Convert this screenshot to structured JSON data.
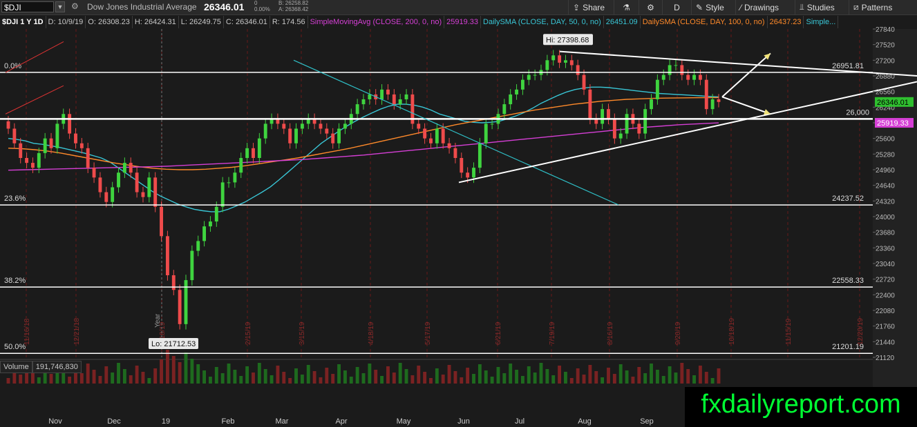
{
  "toolbar": {
    "symbol": "$DJI",
    "description": "Dow Jones Industrial Average",
    "last": "26346.01",
    "change_top": "0",
    "change_pct": "0.00%",
    "bid": "B: 26258.82",
    "ask": "A: 26368.42",
    "share": "Share",
    "period": "D",
    "style": "Style",
    "drawings": "Drawings",
    "studies": "Studies",
    "patterns": "Patterns"
  },
  "header": {
    "title": "$DJI 1 Y 1D",
    "date": "D: 10/9/19",
    "open": "O: 26308.23",
    "high": "H: 26424.31",
    "low": "L: 26249.75",
    "close": "C: 26346.01",
    "range": "R: 174.56",
    "sma200_label": "SimpleMovingAvg (CLOSE, 200, 0, no)",
    "sma200_value": "25919.33",
    "sma50_label": "DailySMA (CLOSE, DAY, 50, 0, no)",
    "sma50_value": "26451.09",
    "sma100_label": "DailySMA (CLOSE, DAY, 100, 0, no)",
    "sma100_value": "26437.23",
    "more": "Simple..."
  },
  "volume": {
    "label": "Volume",
    "value": "191,746,830"
  },
  "watermark": "fxdailyreport.com",
  "colors": {
    "up": "#3fd43f",
    "down": "#ef4b4b",
    "sma50": "#39c6d6",
    "sma100": "#ff8a2a",
    "sma200": "#d63fd6",
    "fib": "#ffffff",
    "downtrend": "#2fc0c8"
  },
  "chart_data": {
    "type": "candlestick",
    "ylim": [
      21120,
      27840
    ],
    "y_ticks": [
      "27840",
      "27520",
      "27200",
      "26880",
      "26560",
      "26240",
      "25920",
      "25600",
      "25280",
      "24960",
      "24640",
      "24320",
      "24000",
      "23680",
      "23360",
      "23040",
      "22720",
      "22400",
      "22080",
      "21760",
      "21440",
      "21120"
    ],
    "x_ticks": [
      "Nov",
      "Dec",
      "19",
      "Feb",
      "Mar",
      "Apr",
      "May",
      "Jun",
      "Jul",
      "Aug",
      "Sep"
    ],
    "expiry_labels": [
      "11/16/18",
      "12/21/18",
      "1/18/19",
      "2/15/19",
      "3/15/19",
      "4/18/19",
      "5/17/19",
      "6/21/19",
      "7/19/19",
      "8/16/19",
      "9/20/19",
      "10/18/19",
      "11/15/19",
      "12/20/19"
    ],
    "year_label": "Year",
    "fib_levels": [
      {
        "label": "0.0%",
        "price": "26951.81",
        "value": 26951.81
      },
      {
        "label": "23.6%",
        "price": "24237.52",
        "value": 24237.52
      },
      {
        "label": "38.2%",
        "price": "22558.33",
        "value": 22558.33
      },
      {
        "label": "50.0%",
        "price": "21201.19",
        "value": 21201.19
      }
    ],
    "level_26000": {
      "label": "26,000",
      "value": 26000
    },
    "high_label": "Hi: 27398.68",
    "low_label": "Lo: 21712.53",
    "high_value": 27398.68,
    "low_value": 21712.53,
    "last_badge": "26346.01",
    "sma_badge": "25919.33",
    "closes": [
      25800,
      25500,
      25200,
      25100,
      25000,
      25300,
      25600,
      25400,
      25900,
      26100,
      25700,
      25500,
      25400,
      25000,
      24800,
      24500,
      24300,
      24600,
      24900,
      25100,
      24900,
      24500,
      24400,
      24800,
      24200,
      23600,
      22800,
      22500,
      21800,
      22700,
      23300,
      23500,
      23800,
      23900,
      24200,
      24700,
      24700,
      24900,
      25200,
      25400,
      25200,
      25600,
      25900,
      26000,
      25900,
      25800,
      25500,
      25800,
      25900,
      26000,
      25900,
      25800,
      25700,
      25500,
      25800,
      25900,
      26100,
      26300,
      26400,
      26500,
      26400,
      26600,
      26500,
      26300,
      26400,
      26500,
      25900,
      25800,
      25600,
      25500,
      25800,
      25500,
      25400,
      25200,
      24900,
      24800,
      25000,
      25500,
      25900,
      25900,
      26100,
      26300,
      26500,
      26600,
      26800,
      26900,
      26900,
      27000,
      27200,
      27300,
      27150,
      27200,
      27100,
      26900,
      26600,
      26000,
      25900,
      26200,
      26000,
      25600,
      25700,
      26100,
      25900,
      25700,
      26200,
      26400,
      26800,
      26900,
      27100,
      27100,
      26900,
      26800,
      26900,
      26800,
      26200,
      26400,
      26346
    ],
    "sma50": [
      25600,
      25580,
      25550,
      25500,
      25480,
      25450,
      25420,
      25380,
      25340,
      25300,
      25250,
      25200,
      25120,
      25000,
      24880,
      24760,
      24640,
      24520,
      24420,
      24340,
      24260,
      24200,
      24150,
      24120,
      24100,
      24100,
      24150,
      24220,
      24300,
      24400,
      24500,
      24610,
      24750,
      24900,
      25050,
      25200,
      25350,
      25500,
      25620,
      25740,
      25850,
      25950,
      26040,
      26120,
      26200,
      26260,
      26300,
      26300,
      26280,
      26240,
      26180,
      26100,
      26050,
      26000,
      25950,
      25930,
      25920,
      25930,
      25950,
      26000,
      26060,
      26130,
      26220,
      26320,
      26400,
      26480,
      26550,
      26600,
      26630,
      26650,
      26650,
      26640,
      26620,
      26600,
      26580,
      26560,
      26540,
      26520,
      26510,
      26500,
      26490,
      26480,
      26470,
      26460,
      26451
    ],
    "sma100": [
      25400,
      25390,
      25370,
      25340,
      25300,
      25250,
      25200,
      25150,
      25100,
      25060,
      25020,
      24990,
      24970,
      24960,
      24960,
      24970,
      24990,
      25010,
      25040,
      25080,
      25120,
      25160,
      25200,
      25250,
      25300,
      25350,
      25400,
      25460,
      25520,
      25580,
      25640,
      25700,
      25760,
      25820,
      25880,
      25930,
      25980,
      26030,
      26080,
      26130,
      26180,
      26220,
      26260,
      26300,
      26330,
      26360,
      26380,
      26400,
      26410,
      26420,
      26425,
      26430,
      26432,
      26435,
      26437
    ],
    "sma200": [
      24950,
      24960,
      24970,
      24980,
      24990,
      25000,
      25010,
      25020,
      25030,
      25050,
      25070,
      25090,
      25110,
      25130,
      25150,
      25170,
      25200,
      25230,
      25260,
      25300,
      25340,
      25380,
      25420,
      25460,
      25500,
      25540,
      25580,
      25620,
      25660,
      25700,
      25740,
      25780,
      25820,
      25850,
      25880,
      25900,
      25919
    ]
  }
}
